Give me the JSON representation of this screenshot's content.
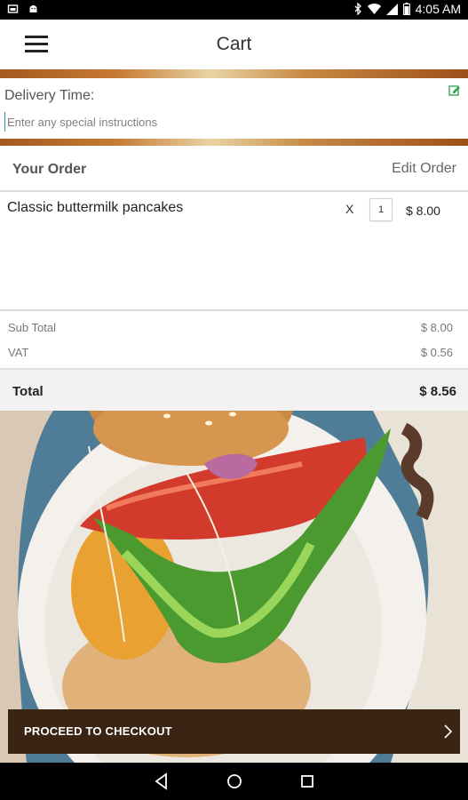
{
  "status_bar": {
    "time": "4:05 AM",
    "left_icons": [
      "image-notification-icon",
      "android-notification-icon"
    ],
    "right_icons": [
      "bluetooth-icon",
      "wifi-icon",
      "signal-icon",
      "battery-icon"
    ]
  },
  "app_bar": {
    "title": "Cart",
    "menu_icon": "hamburger-menu-icon"
  },
  "delivery": {
    "label": "Delivery Time:",
    "instructions_placeholder": "Enter any special instructions",
    "instructions_value": "",
    "edit_icon": "edit-icon"
  },
  "order": {
    "header": "Your Order",
    "edit_label": "Edit Order",
    "items": [
      {
        "name": "Classic buttermilk pancakes",
        "multiplier": "X",
        "quantity": "1",
        "price": "$ 8.00"
      }
    ]
  },
  "summary": {
    "subtotal_label": "Sub Total",
    "subtotal_value": "$ 8.00",
    "vat_label": "VAT",
    "vat_value": "$ 0.56",
    "total_label": "Total",
    "total_value": "$ 8.56"
  },
  "checkout": {
    "label": "PROCEED TO CHECKOUT",
    "arrow_icon": "chevron-right-icon"
  },
  "nav_bar": {
    "buttons": [
      "back-icon",
      "home-icon",
      "recents-icon"
    ]
  },
  "colors": {
    "checkout_bg": "#3b2414",
    "accent_green": "#3aa55a",
    "cursor_blue": "#2a8fb5"
  }
}
